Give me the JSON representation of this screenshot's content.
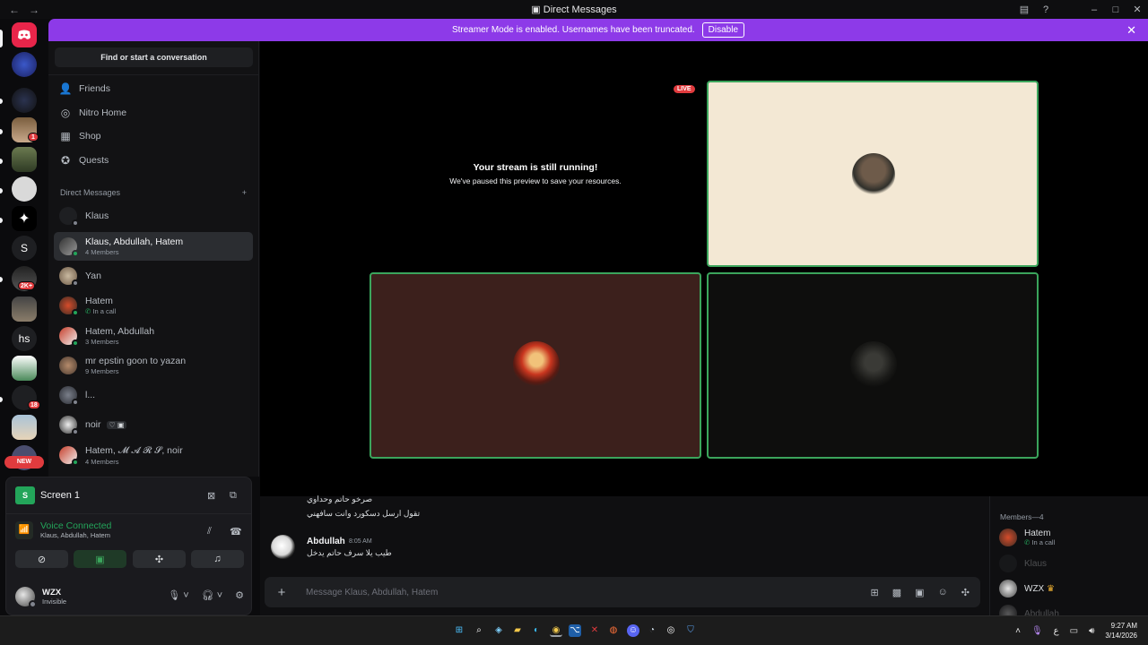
{
  "window": {
    "title": "Direct Messages",
    "nav_back": "←",
    "nav_forward": "→"
  },
  "banner": {
    "text": "Streamer Mode is enabled. Usernames have been truncated.",
    "button": "Disable"
  },
  "rail": {
    "badges": [
      "1",
      "2K+",
      "18"
    ],
    "letters": [
      "S",
      "hs"
    ],
    "new_label": "NEW"
  },
  "sidebar": {
    "search_button": "Find or start a conversation",
    "nav": [
      {
        "label": "Friends",
        "icon": "friends-icon"
      },
      {
        "label": "Nitro Home",
        "icon": "nitro-icon"
      },
      {
        "label": "Shop",
        "icon": "shop-icon"
      },
      {
        "label": "Quests",
        "icon": "quests-icon"
      }
    ],
    "dm_header": "Direct Messages",
    "dm_add": "+",
    "dms": [
      {
        "name": "Klaus",
        "sub": ""
      },
      {
        "name": "Klaus, Abdullah, Hatem",
        "sub": "4 Members"
      },
      {
        "name": "Yan",
        "sub": ""
      },
      {
        "name": "Hatem",
        "sub": "In a call"
      },
      {
        "name": "Hatem, Abdullah",
        "sub": "3 Members"
      },
      {
        "name": "mr epstin goon to yazan",
        "sub": "9 Members"
      },
      {
        "name": "l...",
        "sub": ""
      },
      {
        "name": "noir",
        "sub": ""
      },
      {
        "name": "Hatem, 𝓜 𝓐 𝓡 𝓢, noir",
        "sub": "4 Members"
      }
    ]
  },
  "voice": {
    "screen_label": "Screen 1",
    "status": "Voice Connected",
    "channel": "Klaus, Abdullah, Hatem",
    "user_name": "WZX",
    "user_status": "Invisible"
  },
  "stage": {
    "paused_title": "Your stream is still running!",
    "paused_sub": "We've paused this preview to save your resources.",
    "live_badge": "LIVE"
  },
  "chat": {
    "prev_lines": [
      "صرخو حاتم وحداوي",
      "تقول ارسل دسكورد وانت سافهني"
    ],
    "message_author": "Abdullah",
    "message_time": "8:05 AM",
    "message_text": "طيب يلا سرف حاتم يدخل",
    "composer_placeholder": "Message Klaus, Abdullah, Hatem"
  },
  "members": {
    "header": "Members—4",
    "list": [
      {
        "name": "Hatem",
        "sub": "In a call"
      },
      {
        "name": "Klaus",
        "sub": ""
      },
      {
        "name": "WZX",
        "sub": ""
      },
      {
        "name": "Abdullah",
        "sub": ""
      }
    ]
  },
  "taskbar": {
    "time": "9:27 AM",
    "date": "3/14/2026",
    "lang": "ع"
  },
  "colors": {
    "accent": "#8d3ae8",
    "green": "#3ba55c",
    "danger": "#e03b3e"
  }
}
